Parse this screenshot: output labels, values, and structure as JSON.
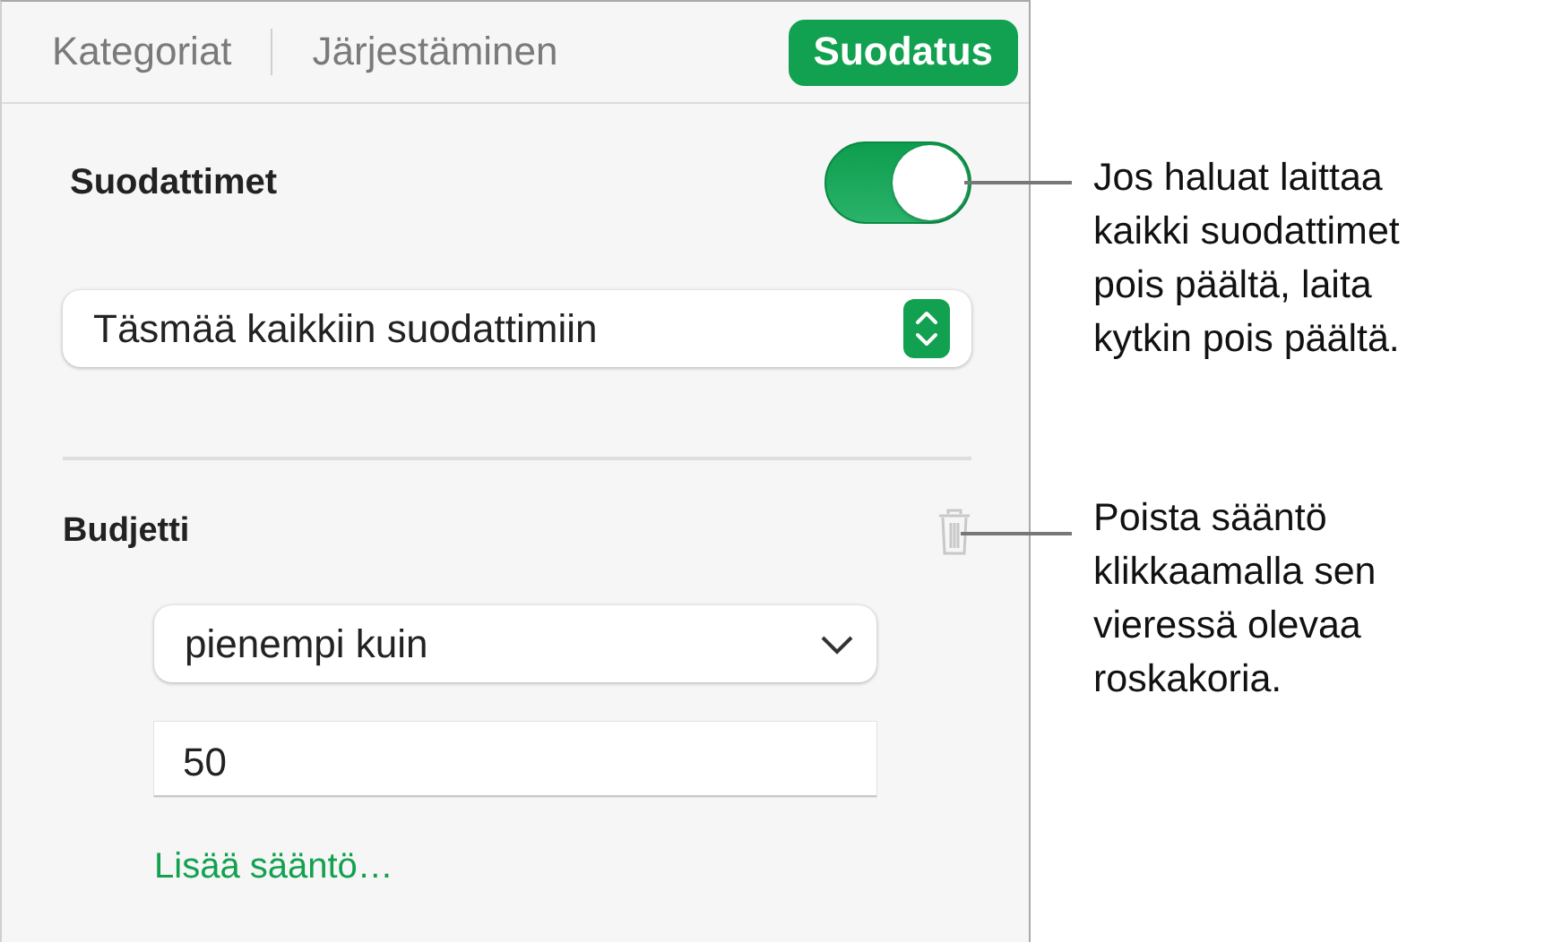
{
  "tabs": [
    {
      "label": "Kategoriat",
      "selected": false
    },
    {
      "label": "Järjestäminen",
      "selected": false
    },
    {
      "label": "Suodatus",
      "selected": true
    }
  ],
  "filters": {
    "label": "Suodattimet",
    "on": true
  },
  "match_select": {
    "value": "Täsmää kaikkiin suodattimiin"
  },
  "rule": {
    "label": "Budjetti",
    "condition": "pienempi kuin",
    "value": "50"
  },
  "add_rule_link": "Lisää sääntö…",
  "callouts": [
    {
      "lines": [
        "Jos haluat laittaa",
        "kaikki suodattimet",
        "pois päältä, laita",
        "kytkin pois päältä."
      ]
    },
    {
      "lines": [
        "Poista sääntö",
        "klikkaamalla sen",
        "vieressä olevaa",
        "roskakoria."
      ]
    }
  ]
}
